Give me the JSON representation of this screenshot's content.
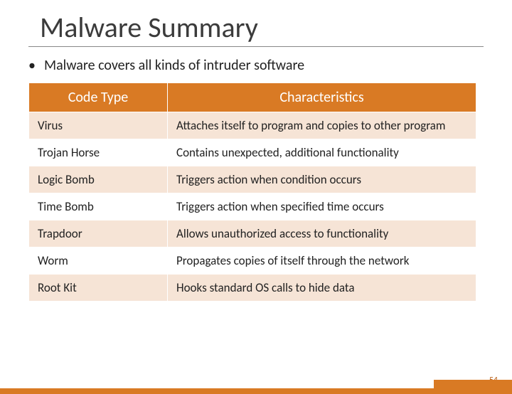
{
  "title": "Malware Summary",
  "bullet": "Malware covers all kinds of intruder software",
  "table": {
    "headers": [
      "Code Type",
      "Characteristics"
    ],
    "rows": [
      {
        "type": "Virus",
        "char": "Attaches itself to program and copies to other program"
      },
      {
        "type": "Trojan Horse",
        "char": "Contains unexpected, additional  functionality"
      },
      {
        "type": "Logic Bomb",
        "char": "Triggers action when condition occurs"
      },
      {
        "type": "Time Bomb",
        "char": "Triggers action when specified time occurs"
      },
      {
        "type": "Trapdoor",
        "char": "Allows unauthorized access to functionality"
      },
      {
        "type": "Worm",
        "char": "Propagates copies of itself through the network"
      },
      {
        "type": "Root Kit",
        "char": "Hooks standard OS calls to hide data"
      }
    ]
  },
  "page_number": "54"
}
